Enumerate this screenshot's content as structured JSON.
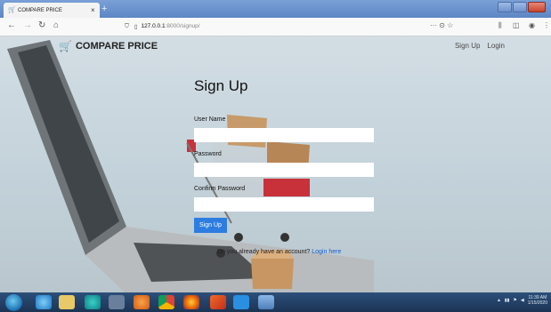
{
  "browser": {
    "tab_title": "COMPARE PRICE",
    "tab_close": "×",
    "new_tab": "+",
    "url_host": "127.0.0.1",
    "url_path": ":8000/signup/",
    "page_actions": "··· ⊙ ☆"
  },
  "site": {
    "brand": "COMPARE PRICE",
    "nav_signup": "Sign Up",
    "nav_login": "Login"
  },
  "form": {
    "title": "Sign Up",
    "username_label": "User Name",
    "password_label": "Password",
    "confirm_label": "Confirm Password",
    "submit_label": "Sign Up",
    "already_text": "Do you already have an account?",
    "login_link": "Login here"
  },
  "taskbar": {
    "time": "11:39 AM",
    "date": "1/15/2020"
  },
  "colors": {
    "accent": "#2d7de0",
    "link": "#1a5fd0",
    "taskbar": "#1c3454"
  }
}
